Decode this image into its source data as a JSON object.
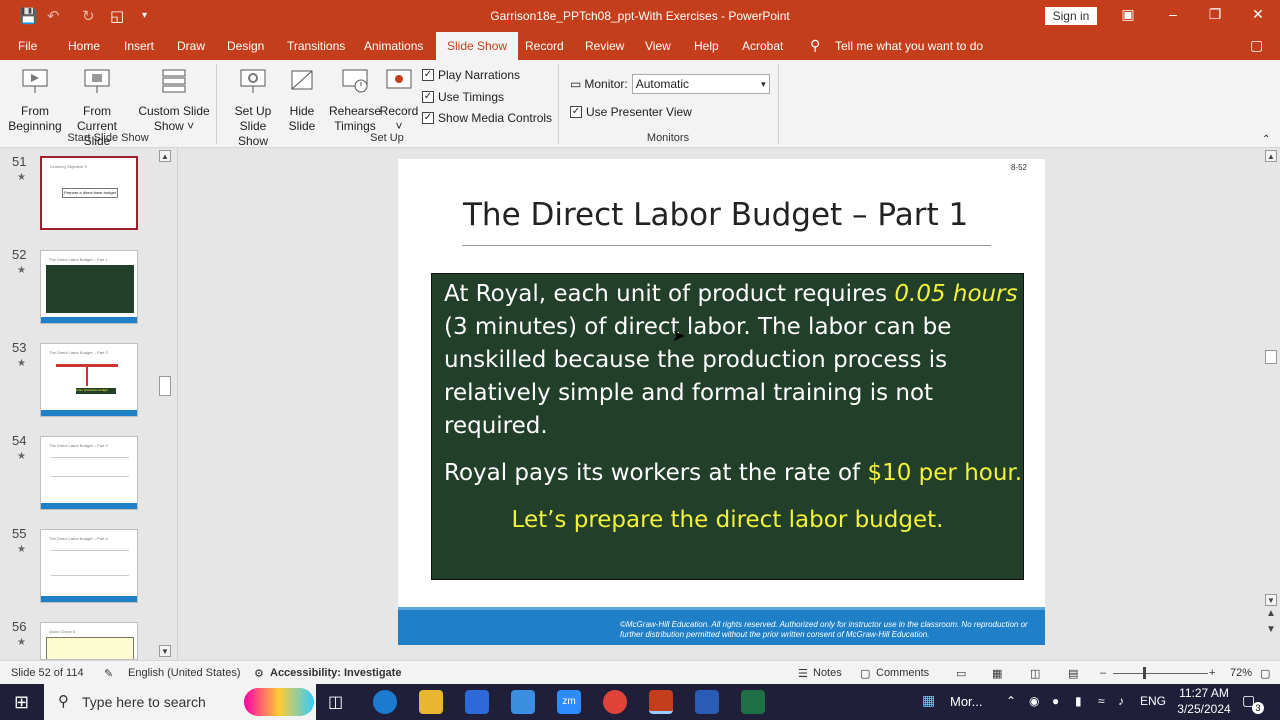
{
  "window": {
    "title": "Garrison18e_PPTch08_ppt-With Exercises  -  PowerPoint",
    "sign_in": "Sign in"
  },
  "tabs": [
    "File",
    "Home",
    "Insert",
    "Draw",
    "Design",
    "Transitions",
    "Animations",
    "Slide Show",
    "Record",
    "Review",
    "View",
    "Help",
    "Acrobat"
  ],
  "active_tab": "Slide Show",
  "tell_me": "Tell me what you want to do",
  "ribbon": {
    "from_beginning": [
      "From",
      "Beginning"
    ],
    "from_current": [
      "From",
      "Current Slide"
    ],
    "custom_show": [
      "Custom Slide",
      "Show"
    ],
    "group_start": "Start Slide Show",
    "setup_show": [
      "Set Up",
      "Slide Show"
    ],
    "hide_slide": [
      "Hide",
      "Slide"
    ],
    "rehearse": [
      "Rehearse",
      "Timings"
    ],
    "record": "Record",
    "play_narrations": "Play Narrations",
    "use_timings": "Use Timings",
    "show_media": "Show Media Controls",
    "group_setup": "Set Up",
    "monitor_label": "Monitor:",
    "monitor_value": "Automatic",
    "presenter_view": "Use Presenter View",
    "group_monitors": "Monitors"
  },
  "thumbnails": [
    {
      "num": "51",
      "title": "Learning Objective 5",
      "text": "Prepare a direct labor budget"
    },
    {
      "num": "52",
      "title": "The Direct Labor Budget – Part 1",
      "text": ""
    },
    {
      "num": "53",
      "title": "The Direct Labor Budget – Part 2",
      "text": "From production budget"
    },
    {
      "num": "54",
      "title": "The Direct Labor Budget – Part 3",
      "text": ""
    },
    {
      "num": "55",
      "title": "The Direct Labor Budget – Part 4",
      "text": ""
    },
    {
      "num": "56",
      "title": "Quick Check 5",
      "text": ""
    }
  ],
  "slide": {
    "page_num": "8-52",
    "title": "The Direct Labor Budget – Part 1",
    "p1_a": "At Royal, each unit of product requires ",
    "p1_hl": "0.05 hours",
    "p1_b": " (3 minutes) of direct labor. The labor can be unskilled because the production process is relatively simple and formal training is not required.",
    "p2_a": "Royal pays its workers at the rate of ",
    "p2_hl": "$10 per hour.",
    "p3": "Let’s prepare the direct labor budget.",
    "copyright": "©McGraw-Hill Education. All rights reserved. Authorized only for instructor use in the classroom.  No reproduction or further distribution permitted without the prior written consent of McGraw-Hill Education."
  },
  "status": {
    "slide_count": "Slide 52 of 114",
    "language": "English (United States)",
    "accessibility": "Accessibility: Investigate",
    "notes": "Notes",
    "comments": "Comments",
    "zoom": "72%"
  },
  "taskbar": {
    "search_placeholder": "Type here to search",
    "more": "Mor...",
    "lang": "ENG",
    "time": "11:27 AM",
    "date": "3/25/2024",
    "notifications": "3"
  }
}
